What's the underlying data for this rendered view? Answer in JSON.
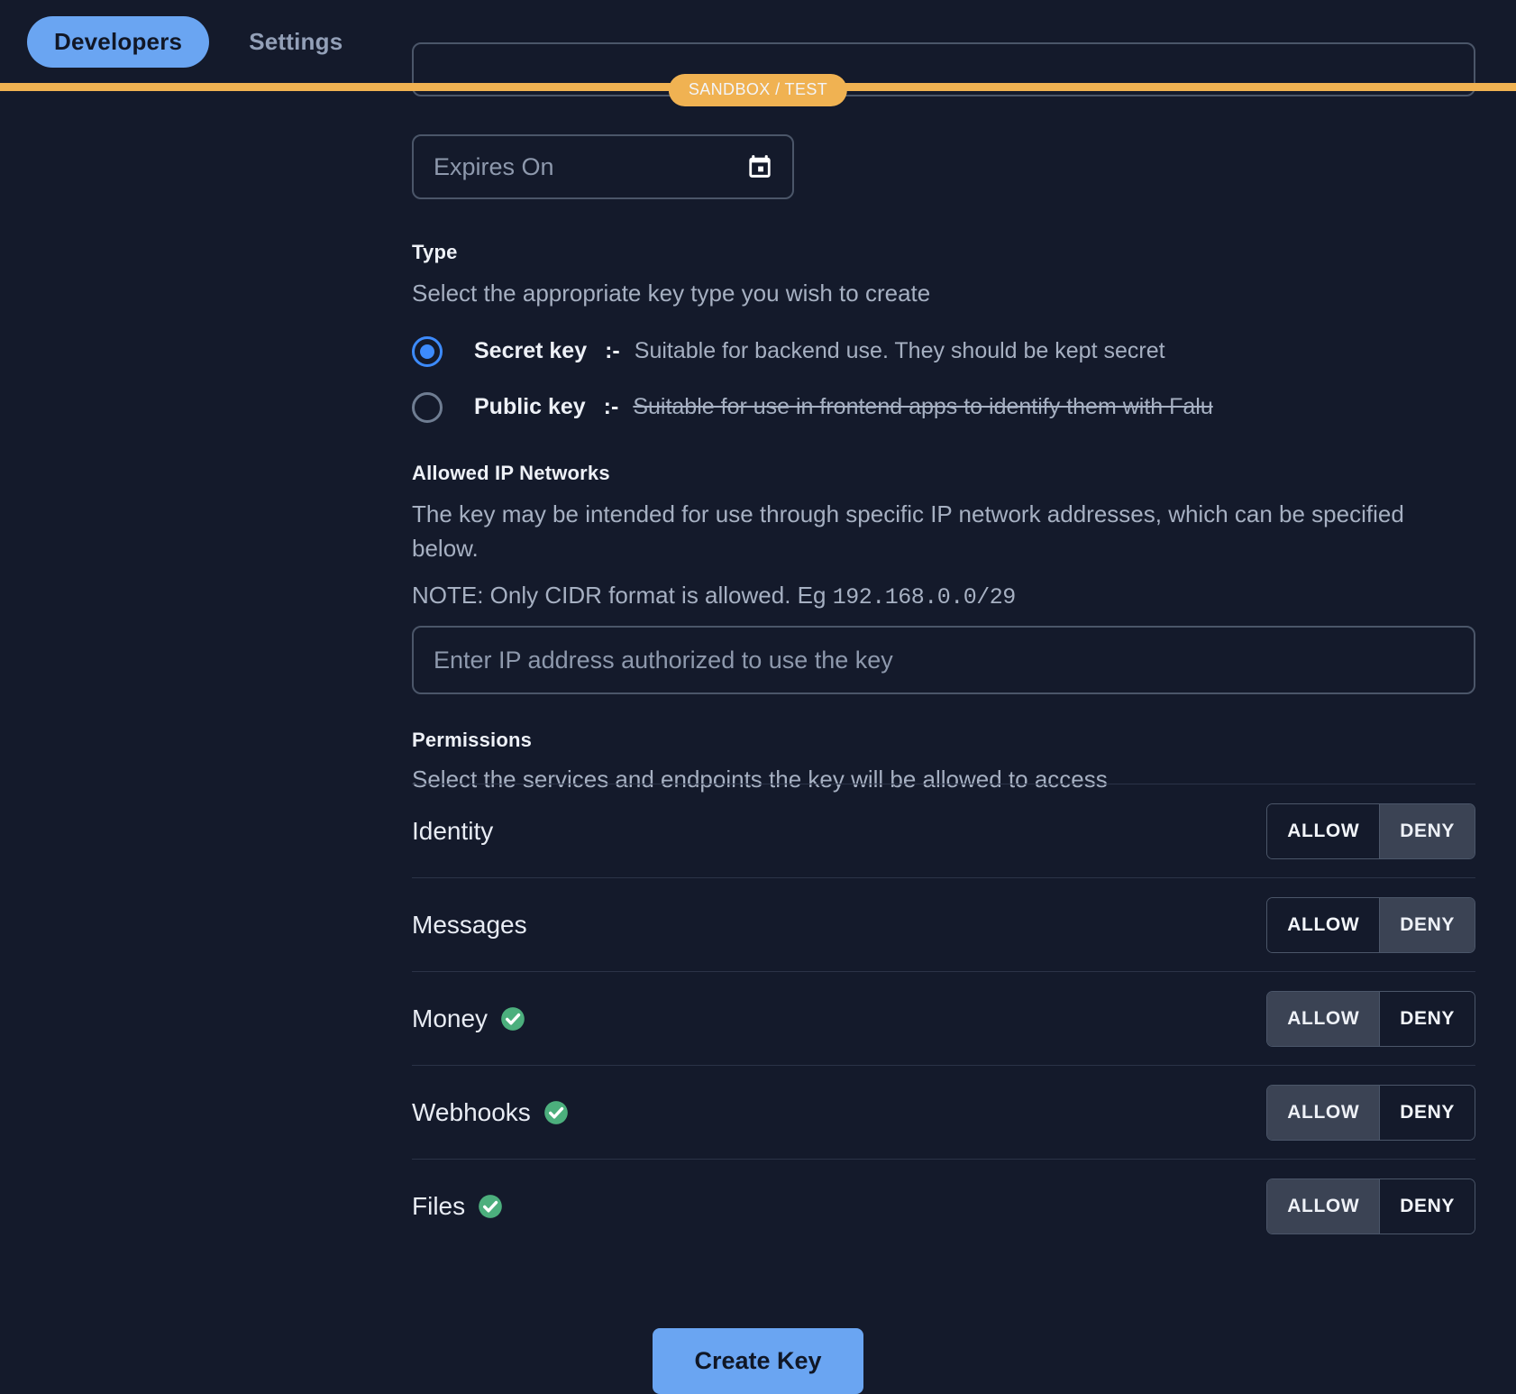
{
  "nav": {
    "tabs": [
      {
        "label": "Developers",
        "active": true
      },
      {
        "label": "Settings",
        "active": false
      }
    ]
  },
  "environment_banner": {
    "label": "SANDBOX / TEST",
    "color": "#f0b252"
  },
  "form": {
    "expires": {
      "placeholder": "Expires On",
      "value": "",
      "icon": "calendar-icon"
    },
    "type": {
      "title": "Type",
      "description": "Select the appropriate key type you wish to create",
      "options": [
        {
          "label": "Secret key",
          "separator": ":-",
          "description": "Suitable for backend use. They should be kept secret",
          "selected": true,
          "struck": false
        },
        {
          "label": "Public key",
          "separator": ":-",
          "description": "Suitable for use in frontend apps to identify them with Falu",
          "selected": false,
          "struck": true
        }
      ]
    },
    "allowed_ip": {
      "title": "Allowed IP Networks",
      "description": "The key may be intended for use through specific IP network addresses, which can be specified below.",
      "note_prefix": "NOTE: Only CIDR format is allowed. Eg ",
      "note_example": "192.168.0.0/29",
      "input_placeholder": "Enter IP address authorized to use the key",
      "input_value": ""
    },
    "permissions": {
      "title": "Permissions",
      "description": "Select the services and endpoints the key will be allowed to access",
      "allow_label": "ALLOW",
      "deny_label": "DENY",
      "rows": [
        {
          "name": "Identity",
          "verified": false,
          "state": "deny"
        },
        {
          "name": "Messages",
          "verified": false,
          "state": "deny"
        },
        {
          "name": "Money",
          "verified": true,
          "state": "allow"
        },
        {
          "name": "Webhooks",
          "verified": true,
          "state": "allow"
        },
        {
          "name": "Files",
          "verified": true,
          "state": "allow"
        }
      ]
    },
    "submit": {
      "label": "Create Key",
      "color": "#6aa5f2"
    }
  },
  "colors": {
    "background": "#141a2b",
    "accent": "#6aa5f2",
    "radio_selected": "#3d8bfd",
    "verified_badge": "#4caf7d",
    "divider": "#2b3347",
    "border": "#4b5669"
  }
}
